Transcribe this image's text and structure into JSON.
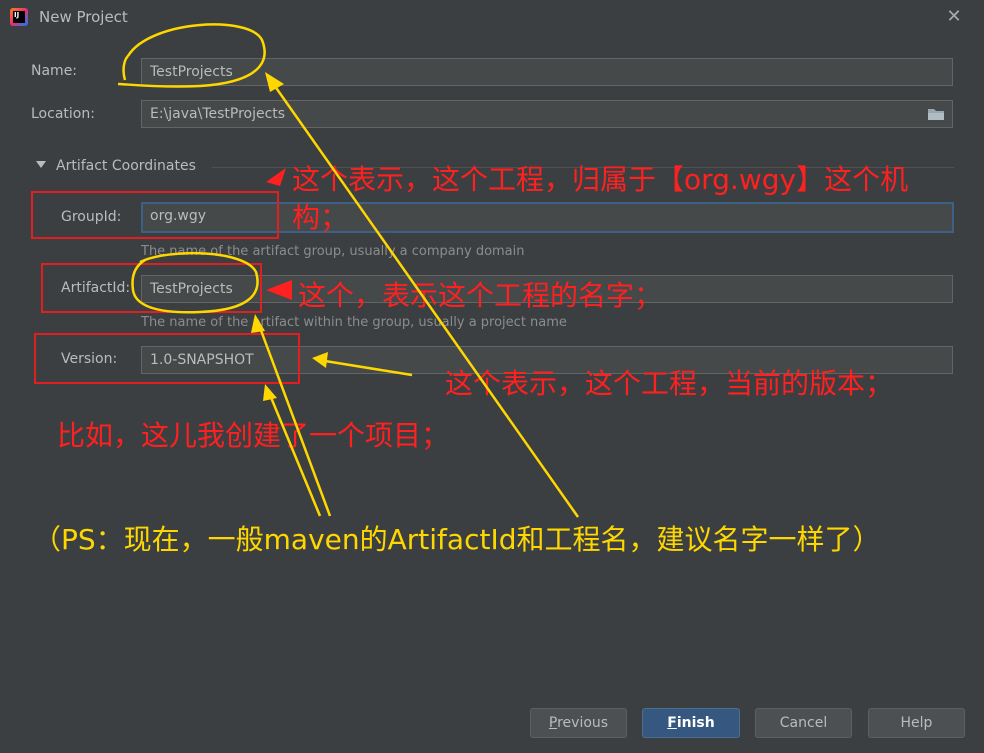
{
  "window": {
    "title": "New Project",
    "app_icon_text": "IJ"
  },
  "form": {
    "name": {
      "label": "Name:",
      "value": "TestProjects"
    },
    "location": {
      "label": "Location:",
      "value": "E:\\java\\TestProjects"
    },
    "section": {
      "label": "Artifact Coordinates"
    },
    "group_id": {
      "label": "GroupId:",
      "value": "org.wgy",
      "hint": "The name of the artifact group, usually a company domain"
    },
    "artifact_id": {
      "label": "ArtifactId:",
      "value": "TestProjects",
      "hint": "The name of the artifact within the group, usually a project name"
    },
    "version": {
      "label": "Version:",
      "value": "1.0-SNAPSHOT"
    }
  },
  "buttons": {
    "previous": {
      "mnemonic": "P",
      "rest": "revious"
    },
    "finish": {
      "mnemonic": "F",
      "rest": "inish"
    },
    "cancel": "Cancel",
    "help": "Help"
  },
  "annotations": {
    "group_note_line1": "这个表示，这个工程，归属于【org.wgy】这个机",
    "group_note_line2": "构；",
    "artifact_note": "这个，表示这个工程的名字；",
    "version_note": "这个表示，这个工程，当前的版本；",
    "example_note": "比如，这儿我创建了一个项目；",
    "ps_note": "（PS：现在，一般maven的ArtifactId和工程名，建议名字一样了）"
  },
  "colors": {
    "background": "#3c3f41",
    "field_bg": "#45494a",
    "primary_button": "#365880",
    "annotation_red": "#ff2020",
    "annotation_yellow": "#ffd700"
  },
  "icons": [
    "close-icon",
    "folder-icon",
    "chevron-down-icon",
    "intellij-app-icon"
  ]
}
